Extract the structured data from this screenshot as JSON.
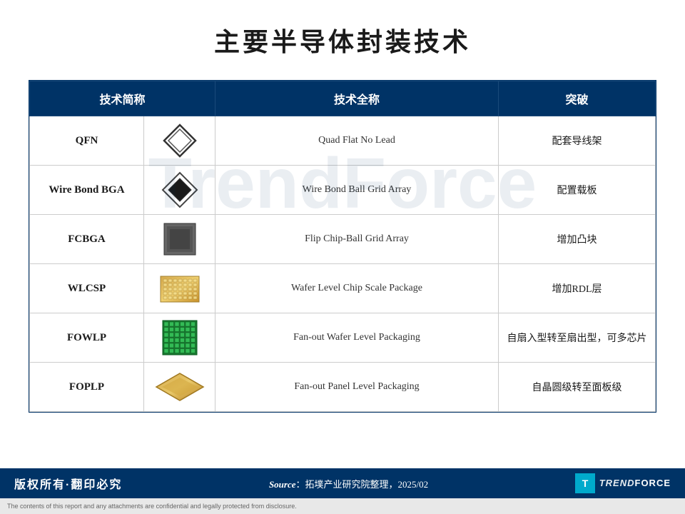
{
  "page": {
    "title": "主要半导体封装技术",
    "table": {
      "headers": [
        "技术简称",
        "",
        "技术全称",
        "突破"
      ],
      "rows": [
        {
          "abbr": "QFN",
          "icon": "qfn",
          "fullname": "Quad Flat No Lead",
          "breakthrough": "配套导线架"
        },
        {
          "abbr": "Wire Bond BGA",
          "icon": "wirebond",
          "fullname": "Wire Bond Ball Grid Array",
          "breakthrough": "配置载板"
        },
        {
          "abbr": "FCBGA",
          "icon": "fcbga",
          "fullname": "Flip Chip-Ball Grid Array",
          "breakthrough": "增加凸块"
        },
        {
          "abbr": "WLCSP",
          "icon": "wlcsp",
          "fullname": "Wafer Level Chip Scale Package",
          "breakthrough": "增加RDL层"
        },
        {
          "abbr": "FOWLP",
          "icon": "fowlp",
          "fullname": "Fan-out Wafer Level Packaging",
          "breakthrough": "自扇入型转至扇出型，可多芯片"
        },
        {
          "abbr": "FOPLP",
          "icon": "foplp",
          "fullname": "Fan-out Panel Level Packaging",
          "breakthrough": "自晶圆级转至面板级"
        }
      ]
    },
    "footer": {
      "left": "版权所有·翻印必究",
      "center": "Source：拓墣产业研究院整理，2025/02",
      "logo_text": "TrendForce",
      "logo_icon": "T"
    },
    "disclaimer": "The contents of this report and any attachments are confidential and legally protected from disclosure."
  }
}
